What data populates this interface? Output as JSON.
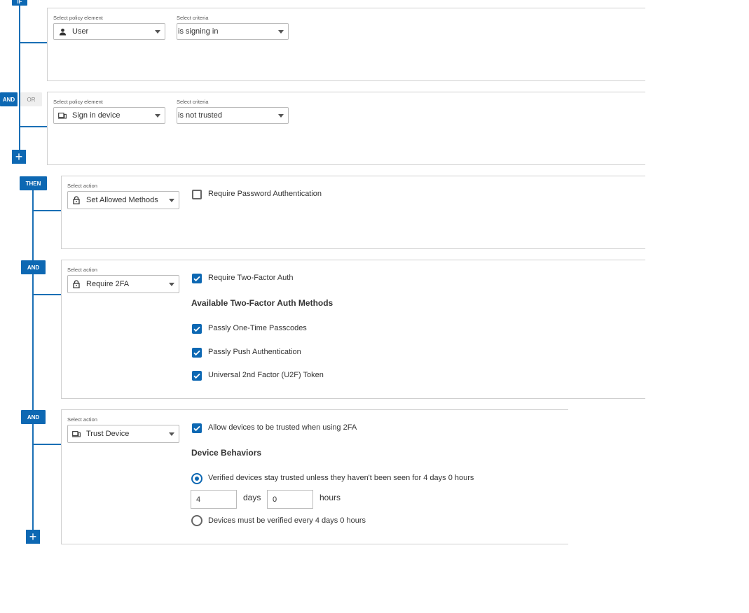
{
  "badges": {
    "if": "IF",
    "and": "AND",
    "or": "OR",
    "then": "THEN",
    "plus": "+"
  },
  "conditions": [
    {
      "element_label": "Select policy element",
      "element_value": "User",
      "element_icon": "user-icon",
      "criteria_label": "Select criteria",
      "criteria_value": "is signing in"
    },
    {
      "element_label": "Select policy element",
      "element_value": "Sign in device",
      "element_icon": "device-icon",
      "criteria_label": "Select criteria",
      "criteria_value": "is not trusted"
    }
  ],
  "actions": [
    {
      "label": "Select action",
      "value": "Set Allowed Methods",
      "icon": "lock-icon",
      "options": [
        {
          "text": "Require Password Authentication",
          "checked": false
        }
      ]
    },
    {
      "label": "Select action",
      "value": "Require 2FA",
      "icon": "lock-icon",
      "primary": {
        "text": "Require Two-Factor Auth",
        "checked": true
      },
      "heading": "Available Two-Factor Auth Methods",
      "methods": [
        {
          "text": "Passly One-Time Passcodes",
          "checked": true
        },
        {
          "text": "Passly Push Authentication",
          "checked": true
        },
        {
          "text": "Universal 2nd Factor (U2F) Token",
          "checked": true
        }
      ]
    },
    {
      "label": "Select action",
      "value": "Trust Device",
      "icon": "device-icon",
      "primary": {
        "text": "Allow devices to be trusted when using 2FA",
        "checked": true
      },
      "heading": "Device Behaviors",
      "radio_options": [
        {
          "text": "Verified devices stay trusted unless they haven't been seen for 4 days 0 hours",
          "selected": true
        },
        {
          "text": "Devices must be verified every 4 days 0 hours",
          "selected": false
        }
      ],
      "days_value": "4",
      "days_unit": "days",
      "hours_value": "0",
      "hours_unit": "hours"
    }
  ],
  "colors": {
    "accent": "#0d68b3",
    "line": "#1a6fb5",
    "border": "#cfcfcf"
  }
}
